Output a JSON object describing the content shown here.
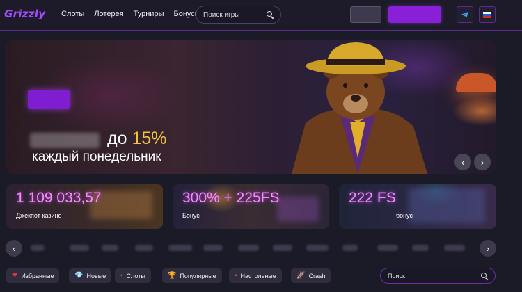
{
  "header": {
    "logo": "Grizzly",
    "nav": [
      "Слоты",
      "Лотерея",
      "Турниры",
      "Бонусы"
    ],
    "search_placeholder": "Поиск игры",
    "language": "RU"
  },
  "hero": {
    "line1_text": "до",
    "line1_percent": "15%",
    "line2": "каждый понедельник",
    "prev_label": "‹",
    "next_label": "›"
  },
  "promos": [
    {
      "value": "1 109 033,57",
      "label": "Джекпот казино"
    },
    {
      "value": "300% + 225FS",
      "label": "Бонус"
    },
    {
      "value": "222 FS",
      "label": "бонус"
    }
  ],
  "provider_strip": {
    "prev_label": "‹",
    "next_label": "›"
  },
  "categories": {
    "items": [
      {
        "icon": "heart-icon",
        "glyph": "❤",
        "label": "Избранные"
      },
      {
        "icon": "diamond-icon",
        "glyph": "💎",
        "label": "Новые"
      },
      {
        "icon": "slot-icon",
        "glyph": "▪",
        "label": "Слоты"
      },
      {
        "icon": "trophy-icon",
        "glyph": "🏆",
        "label": "Популярные"
      },
      {
        "icon": "cards-icon",
        "glyph": "▪",
        "label": "Настольные"
      },
      {
        "icon": "rocket-icon",
        "glyph": "🚀",
        "label": "Crash"
      }
    ],
    "search_placeholder": "Поиск"
  },
  "colors": {
    "accent": "#8a1fd8",
    "promo_text": "#f58cff",
    "highlight": "#f3c23a",
    "background": "#1b1a27"
  }
}
